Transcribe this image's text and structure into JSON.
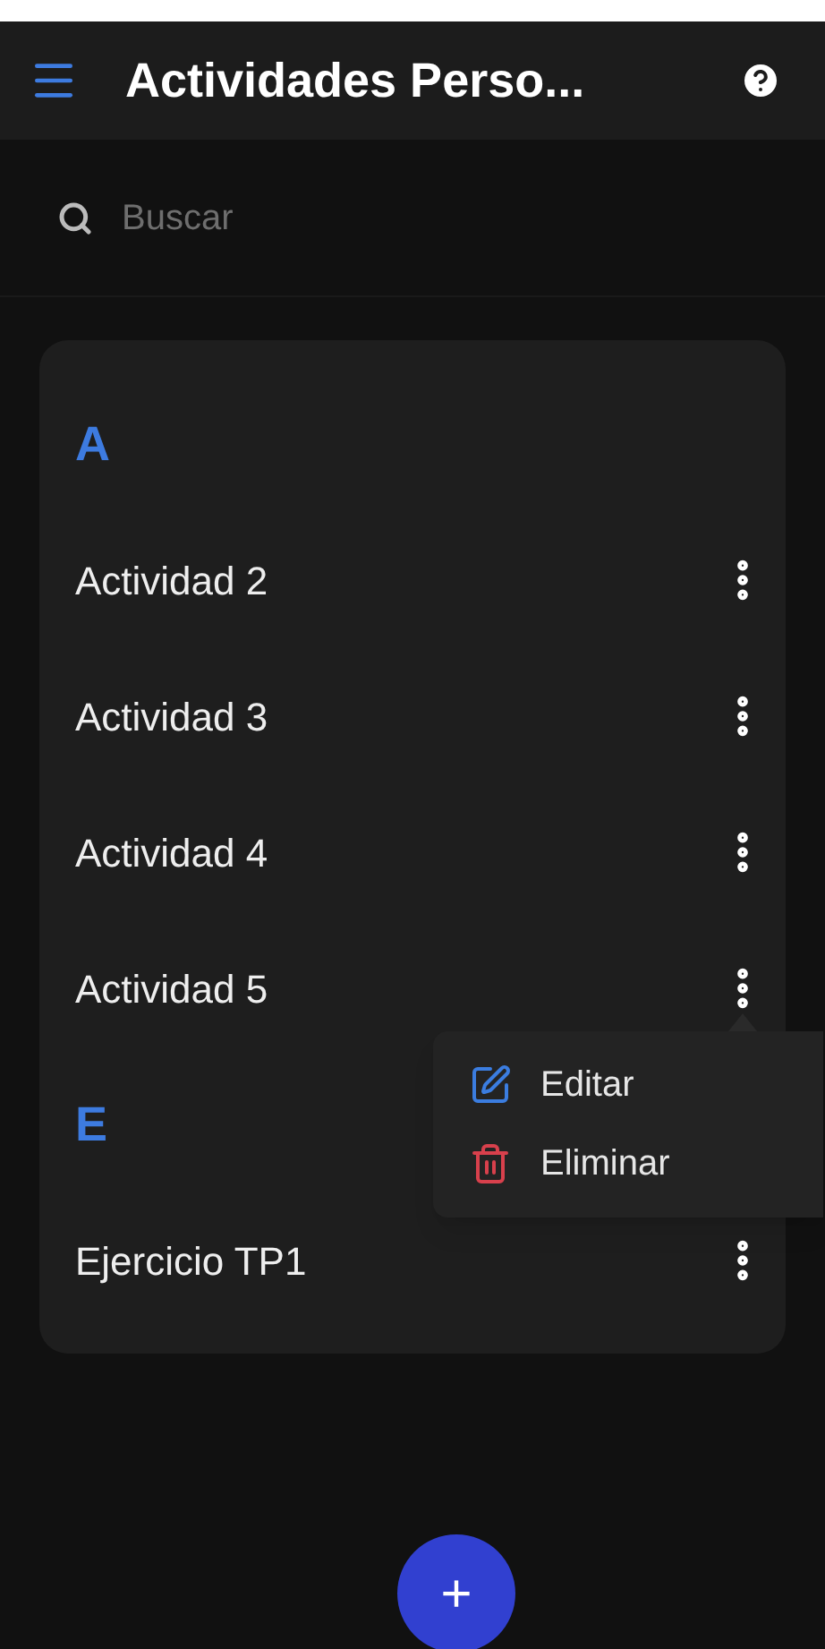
{
  "header": {
    "title": "Actividades Perso..."
  },
  "search": {
    "placeholder": "Buscar"
  },
  "sections": [
    {
      "letter": "A",
      "items": [
        {
          "name": "Actividad 2",
          "menu_open": false
        },
        {
          "name": "Actividad 3",
          "menu_open": false
        },
        {
          "name": "Actividad 4",
          "menu_open": false
        },
        {
          "name": "Actividad 5",
          "menu_open": true
        }
      ]
    },
    {
      "letter": "E",
      "items": [
        {
          "name": "Ejercicio TP1",
          "menu_open": false
        }
      ]
    }
  ],
  "menu": [
    {
      "kind": "edit",
      "label": "Editar"
    },
    {
      "kind": "delete",
      "label": "Eliminar"
    }
  ],
  "fab": {
    "label": "+"
  }
}
